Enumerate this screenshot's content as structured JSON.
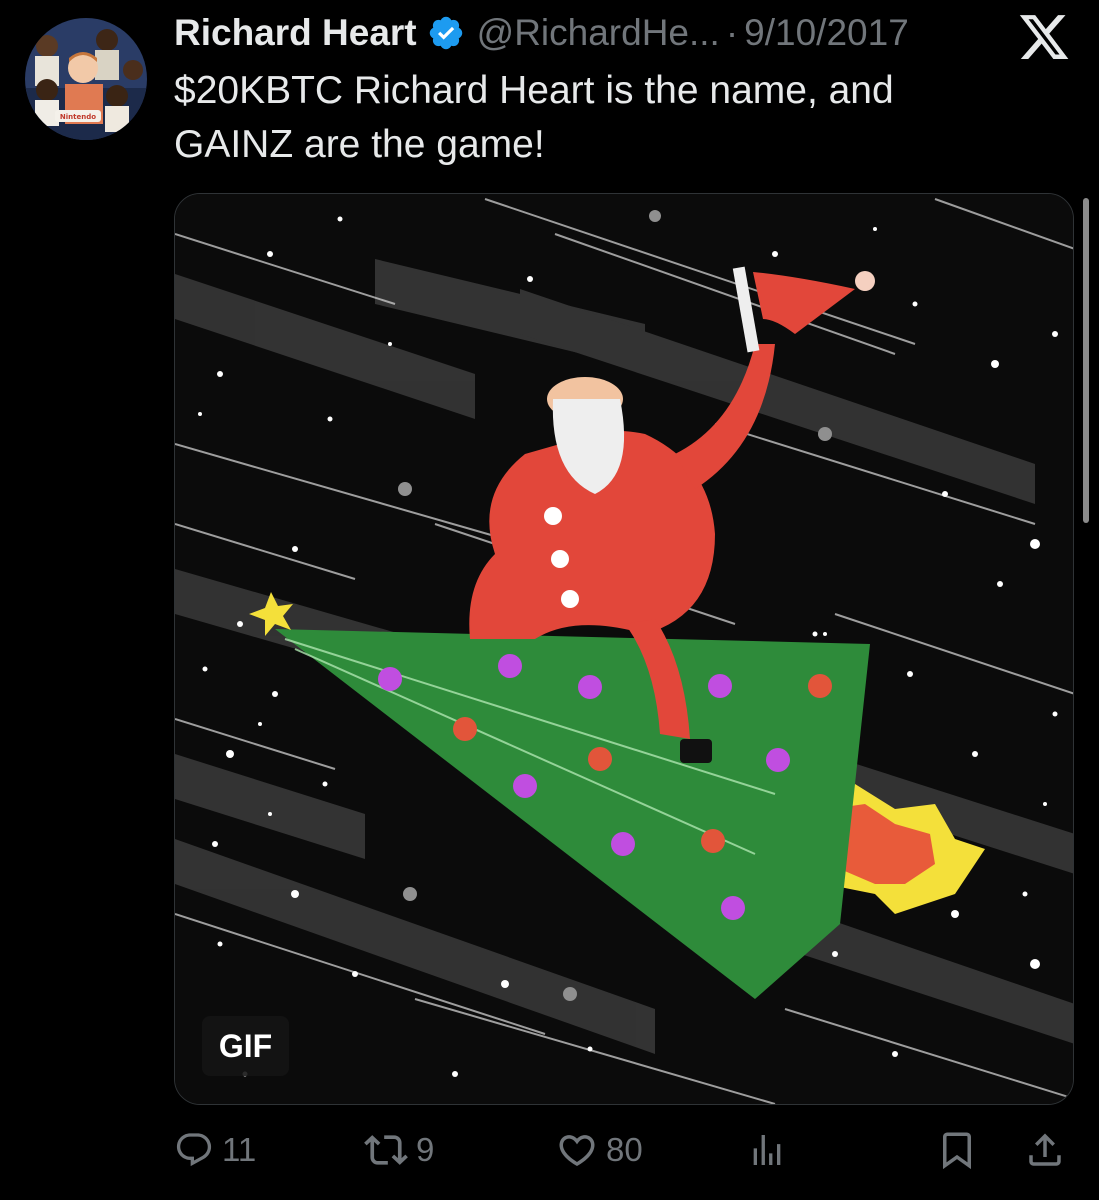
{
  "tweet": {
    "author_name": "Richard Heart",
    "handle": "@RichardHe...",
    "separator": "·",
    "date": "9/10/2017",
    "text_lines": [
      "$20KBTC Richard Heart is the name, and",
      "GAINZ are the game!"
    ],
    "media_badge": "GIF"
  },
  "avatar": {
    "badge_text": "Nintendo"
  },
  "actions": {
    "replies": "11",
    "reposts": "9",
    "likes": "80"
  },
  "icons": {
    "verified": "verified-badge-icon",
    "platform": "x-logo-icon",
    "reply": "reply-icon",
    "repost": "repost-icon",
    "like": "heart-icon",
    "views": "views-icon",
    "bookmark": "bookmark-icon",
    "share": "share-icon"
  },
  "colors": {
    "background": "#000000",
    "text": "#e7e9ea",
    "muted": "#71767b",
    "verified": "#1d9bf0"
  }
}
